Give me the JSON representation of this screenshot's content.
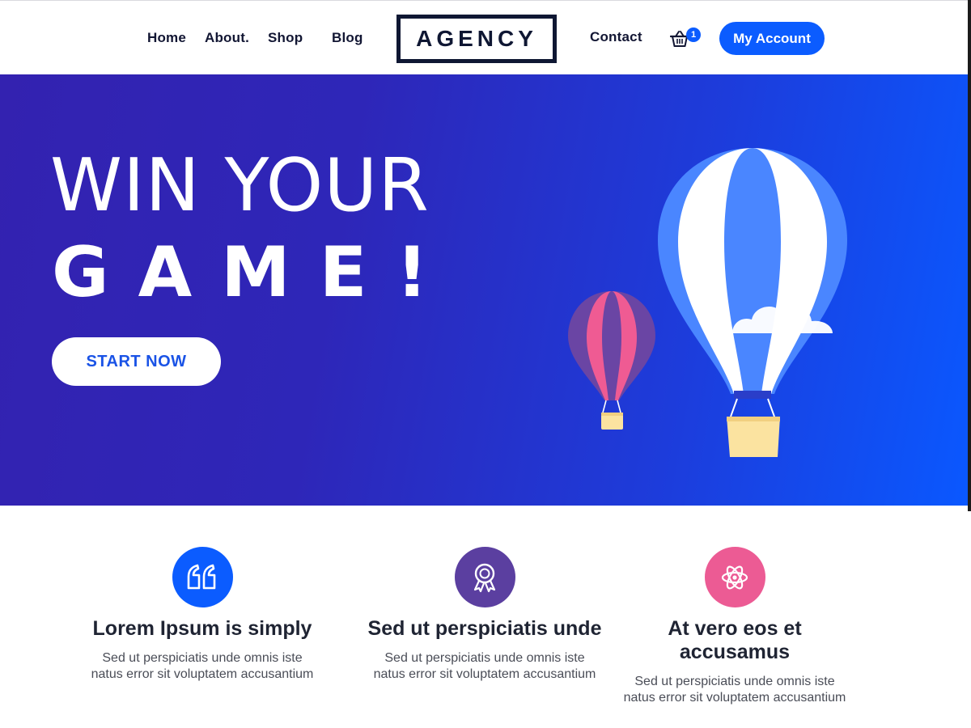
{
  "nav": {
    "links": [
      "Home",
      "About.",
      "Shop",
      "Blog",
      "Contact"
    ],
    "logo": "AGENCY",
    "cart_count": "1",
    "account_label": "My Account"
  },
  "hero": {
    "line1": "WIN YOUR",
    "line2": "GAME!",
    "cta_label": "START NOW"
  },
  "features": [
    {
      "icon": "quote-icon",
      "color": "#0b5cff",
      "title": "Lorem Ipsum is simply",
      "text": "Sed ut perspiciatis unde omnis iste natus error sit voluptatem accusantium"
    },
    {
      "icon": "award-ribbon-icon",
      "color": "#5b3fa0",
      "title": "Sed ut perspiciatis unde",
      "text": "Sed ut perspiciatis unde omnis iste natus error sit voluptatem accusantium"
    },
    {
      "icon": "atom-icon",
      "color": "#ec5b94",
      "title": "At vero eos et accusamus",
      "text": "Sed ut perspiciatis unde omnis iste natus error sit voluptatem accusantium"
    }
  ],
  "colors": {
    "brand_blue": "#0b5cff",
    "hero_start": "#3322b0",
    "hero_end": "#0a58ff",
    "navy": "#0f1733"
  }
}
